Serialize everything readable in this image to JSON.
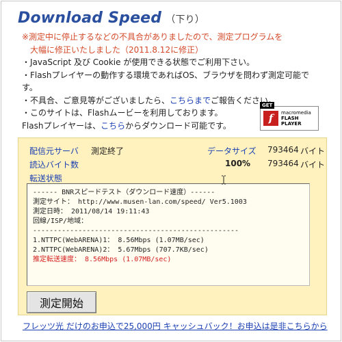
{
  "header": {
    "title": "Download Speed",
    "subtitle": "（下り）"
  },
  "notices": {
    "line1": "※測定中に停止するなどの不具合がありましたので、測定プログラムを",
    "line2": "大幅に修正いたしました（2011.8.12に修正）",
    "bullet1": "・JavaScript 及び Cookie が使用できる状態でご利用下さい。",
    "bullet2a": "・Flashプレイヤーの動作する環境であればOS、ブラウザを問わず測定可能で",
    "bullet2b": "す。",
    "bullet3_pre": "・不具合、ご意見等がございましたら、",
    "bullet3_link": "こちらまで",
    "bullet3_post": "ご報告ください。",
    "bullet4": "・このサイトは、Flashムービーを利用しております。",
    "bullet5_pre": "Flashプレイヤーは、",
    "bullet5_link": "こちら",
    "bullet5_post": "からダウンロード可能です。"
  },
  "flash_badge": {
    "get": "GET",
    "brand": "macromedia",
    "product1": "FLASH",
    "product2": "PLAYER",
    "logo": "f"
  },
  "panel": {
    "source_label": "配信元サーバ",
    "status_value": "測定終了",
    "size_label": "データサイズ",
    "size_value": "793464",
    "size_unit": "バイト",
    "read_label": "読込バイト数",
    "percent": "100%",
    "read_value": "793464",
    "read_unit": "バイト",
    "transfer_label": "転送状態",
    "result": {
      "heading": "------ BNRスピードテスト（ダウンロード速度）------",
      "site": "測定サイト： http://www.musen-lan.com/speed/ Ver5.1003",
      "datetime": "測定日時： 2011/08/14 19:11:43",
      "line_isp": "回線/ISP/地域：",
      "divider": "--------------------------------------------------",
      "result1": "1.NTTPC(WebARENA)1： 8.56Mbps (1.07MB/sec)",
      "result2": "2.NTTPC(WebARENA)2： 5.67Mbps (707.7KB/sec)",
      "estimate": "推定転送速度： 8.56Mbps (1.07MB/sec)"
    },
    "start_button": "測定開始"
  },
  "footer": {
    "text": "フレッツ光 だけのお申込で25,000円 キャッシュバック！お申込は是非こちらから"
  },
  "colors": {
    "title": "#2a4f9e",
    "notice_red": "#d44a2a",
    "link": "#1a3fb3",
    "panel_bg": "#fff2bf",
    "estimate_red": "#d41e1e"
  }
}
